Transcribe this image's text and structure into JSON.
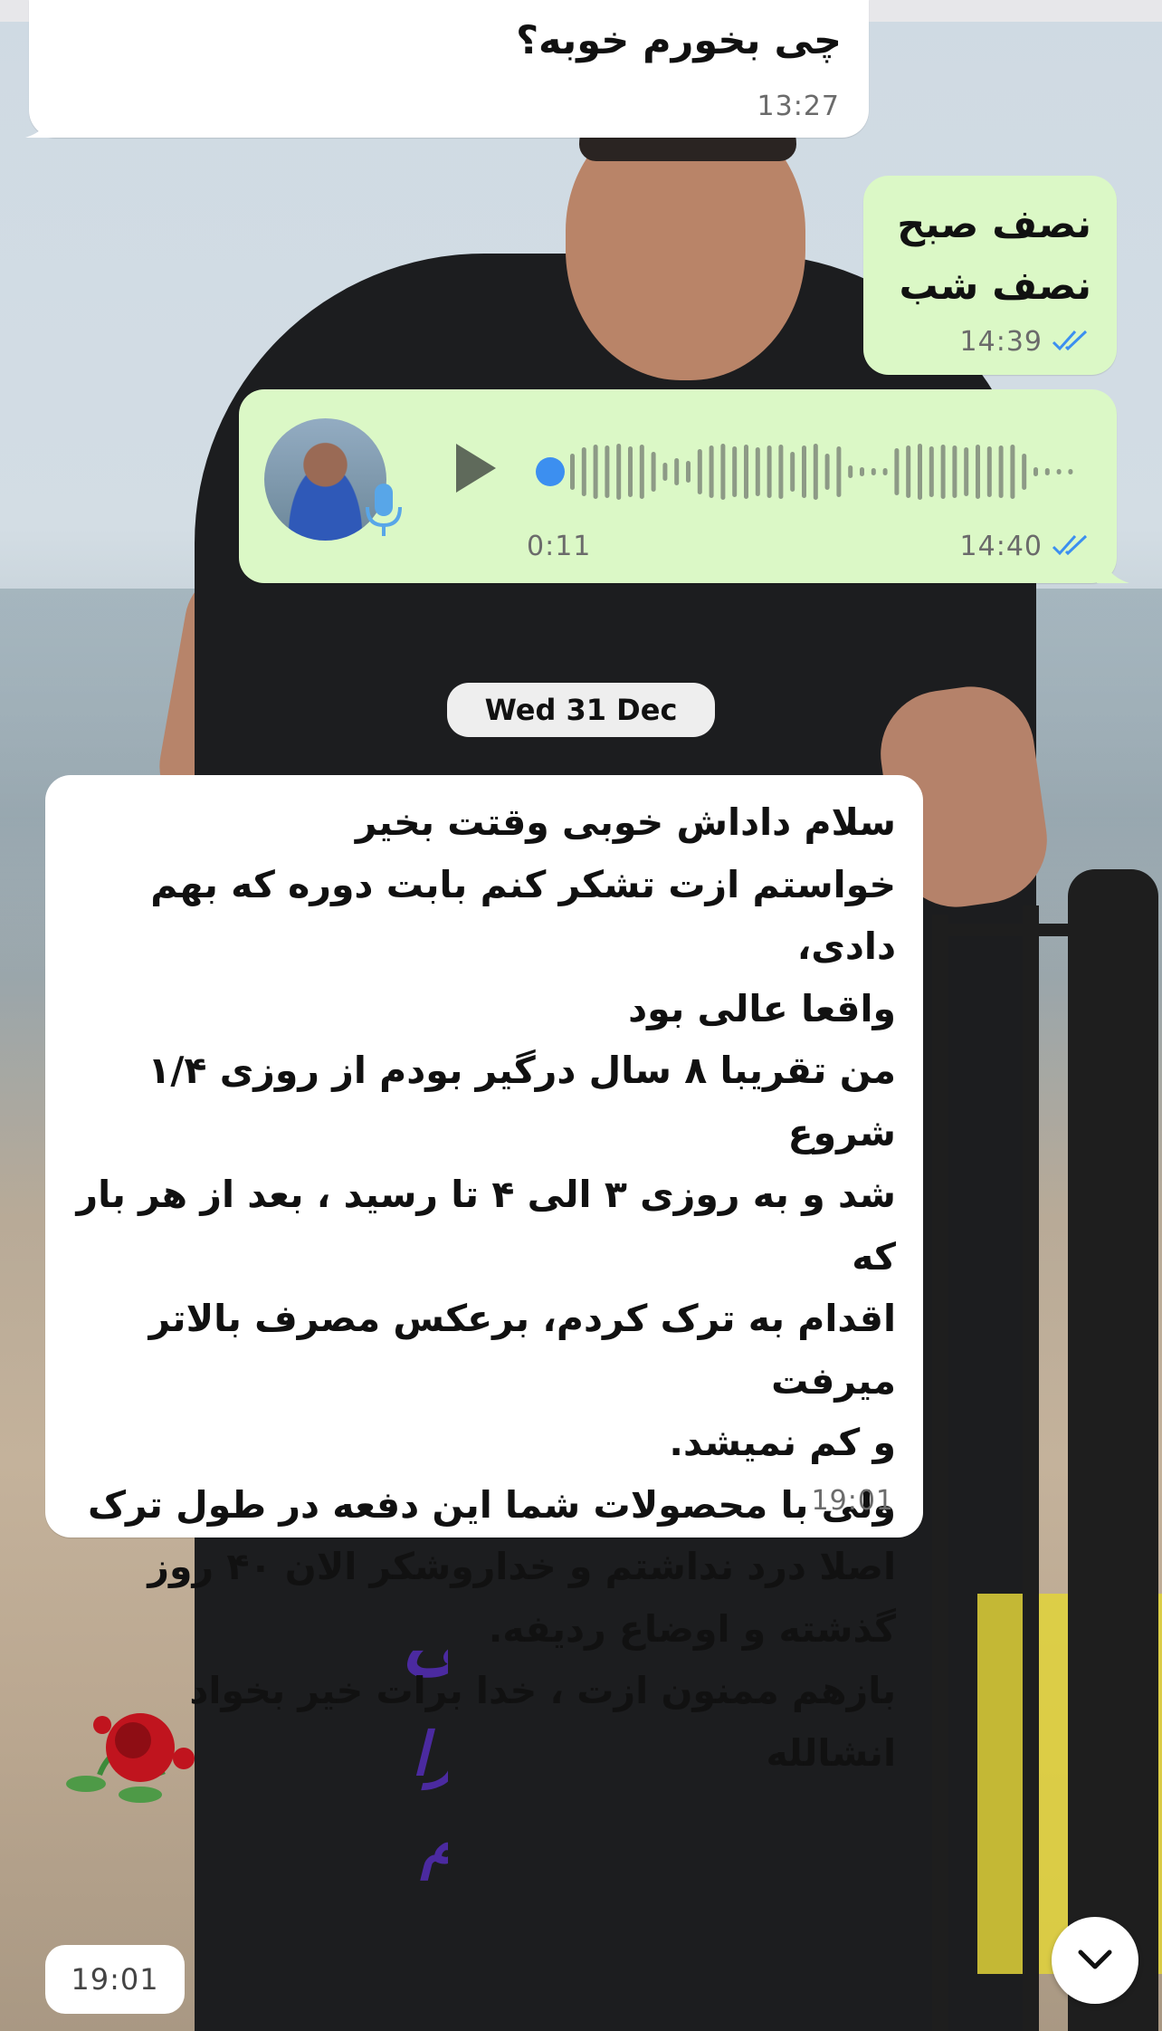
{
  "messages": [
    {
      "direction": "incoming",
      "text": "چی بخورم خوبه؟",
      "time": "13:27"
    },
    {
      "direction": "outgoing",
      "lines": [
        "نصف صبح",
        "نصف شب"
      ],
      "time": "14:39",
      "status": "read"
    },
    {
      "direction": "outgoing",
      "type": "voice",
      "duration": "0:11",
      "time": "14:40",
      "status": "read",
      "icons": [
        "avatar",
        "mic-icon",
        "play-icon",
        "waveform"
      ]
    },
    {
      "direction": "incoming",
      "time": "19:01",
      "text": "سلام داداش خوبی وقتت بخیر\nخواستم ازت تشکر کنم بابت دوره که بهم دادی،\nواقعا عالی بود\nمن تقریبا ۸ سال درگیر بودم از روزی ۱/۴ شروع\nشد و به روزی ۳ الی ۴ تا رسید ، بعد از هر بار که\nاقدام به ترک کردم، برعکس مصرف بالاتر میرفت\nو کم نمیشد.\nولی با محصولات شما این دفعه در طول ترک\nاصلا درد نداشتم و خداروشکر الان ۴۰ روز\nگذشته و اوضاع ردیفه.\nبازهم ممنون ازت ، خدا برات خیر بخواد انشالله"
    }
  ],
  "date_separator": "Wed 31 Dec",
  "overlay": {
    "calligraphy": [
      "از خالق هستی",
      "بهترینها را",
      "برایت آرزو دارم"
    ],
    "time": "19:01"
  },
  "colors": {
    "incoming": "#ffffff",
    "outgoing": "#dbf8c6",
    "read_ticks": "#3c8ff0",
    "calligraphy": "#4b2aa0"
  },
  "scroll_button_icon": "chevron-down-icon"
}
